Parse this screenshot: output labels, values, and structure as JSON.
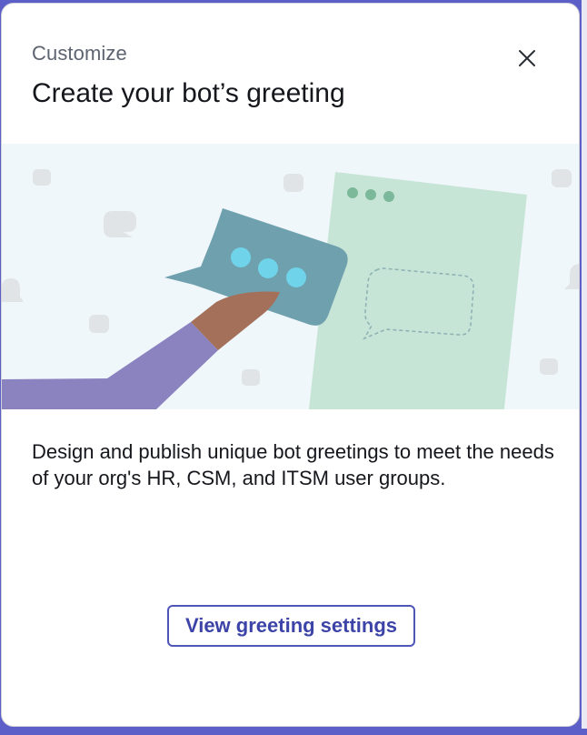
{
  "dialog": {
    "eyebrow": "Customize",
    "title": "Create your bot’s greeting",
    "close_icon": "close-icon",
    "description": "Design and publish unique bot greetings to meet the needs of your org's HR, CSM, and ITSM user groups.",
    "cta_label": "View greeting settings"
  },
  "illustration": {
    "name": "greeting-illustration",
    "colors": {
      "background": "#f0f7fb",
      "bubble": "#6fa0ae",
      "bubble_dots": "#6fd3ea",
      "panel": "#c7e5d6",
      "panel_dots": "#7cb89a",
      "arm": "#8b83c0",
      "hand": "#a4705a",
      "decor_bubbles": "#e1e4e7"
    }
  },
  "theme": {
    "accent": "#4e56b8",
    "frame": "#5b5fc7"
  }
}
